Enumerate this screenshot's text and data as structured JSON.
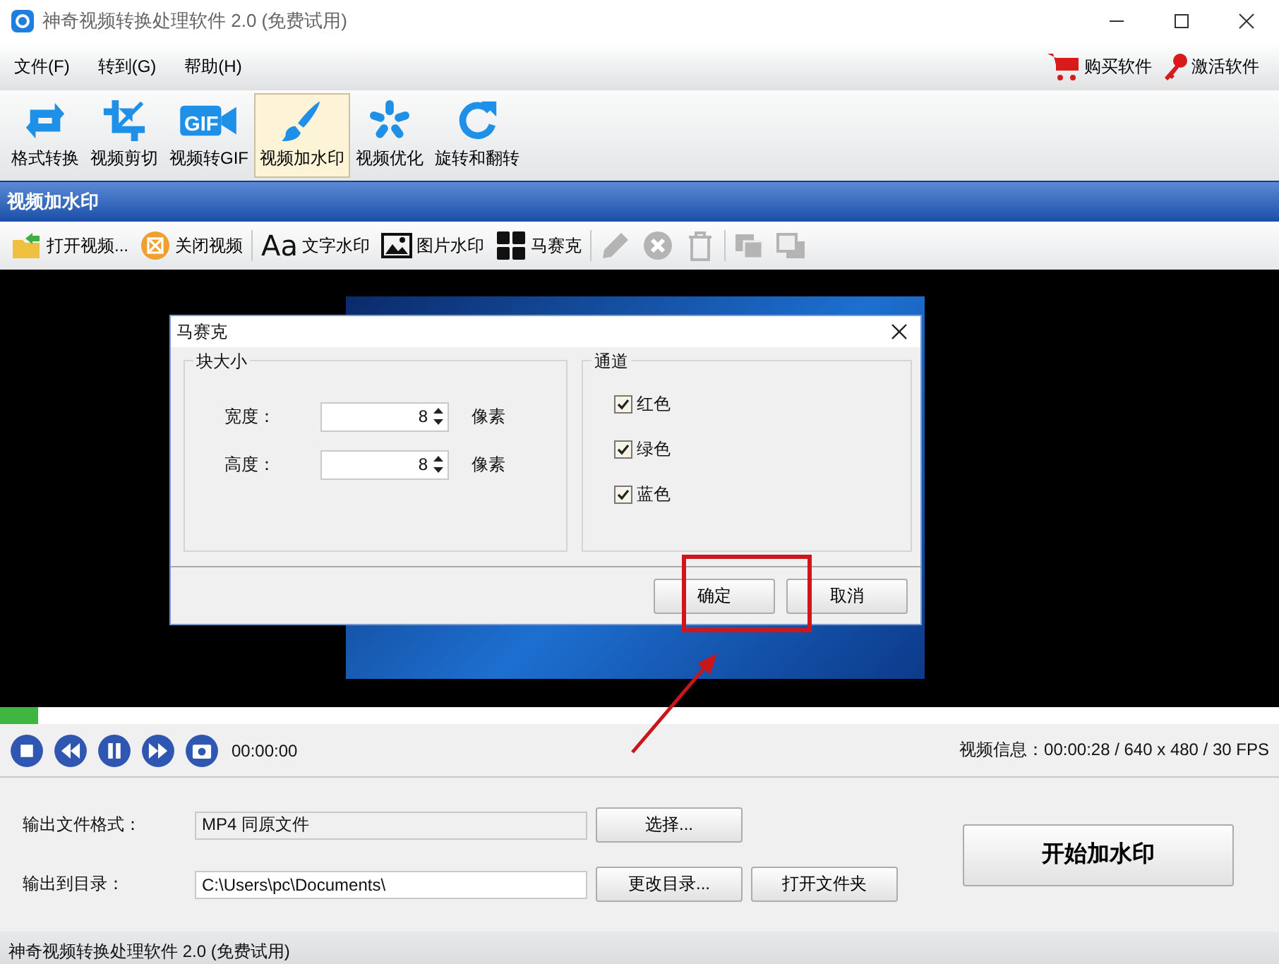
{
  "window": {
    "title": "神奇视频转换处理软件 2.0 (免费试用)"
  },
  "menu": [
    "文件(F)",
    "转到(G)",
    "帮助(H)"
  ],
  "menu_actions": [
    {
      "kind": "cart",
      "label": "购买软件"
    },
    {
      "kind": "key",
      "label": "激活软件"
    }
  ],
  "tools": [
    {
      "kind": "convert",
      "label": "格式转换",
      "selected": false
    },
    {
      "kind": "crop",
      "label": "视频剪切",
      "selected": false
    },
    {
      "kind": "gif",
      "icon_text": "GIF",
      "label": "视频转GIF",
      "selected": false
    },
    {
      "kind": "brush",
      "label": "视频加水印",
      "selected": true
    },
    {
      "kind": "optimize",
      "label": "视频优化",
      "selected": false
    },
    {
      "kind": "rotate",
      "label": "旋转和翻转",
      "selected": false
    }
  ],
  "section_title": "视频加水印",
  "actions": [
    {
      "kind": "open",
      "label": "打开视频...",
      "disabled": false
    },
    {
      "kind": "close",
      "label": "关闭视频",
      "disabled": false
    },
    {
      "kind": "text",
      "icon_text": "Aa",
      "label": "文字水印",
      "disabled": false
    },
    {
      "kind": "image",
      "label": "图片水印",
      "disabled": false
    },
    {
      "kind": "mosaic",
      "label": "马赛克",
      "disabled": false
    },
    {
      "kind": "edit",
      "disabled": true
    },
    {
      "kind": "remove",
      "disabled": true
    },
    {
      "kind": "delete",
      "disabled": true
    },
    {
      "kind": "back",
      "disabled": true
    },
    {
      "kind": "front",
      "disabled": true
    }
  ],
  "dialog": {
    "title": "马赛克",
    "block_size": {
      "title": "块大小",
      "fields": [
        {
          "label": "宽度：",
          "value": "8",
          "unit": "像素"
        },
        {
          "label": "高度：",
          "value": "8",
          "unit": "像素"
        }
      ]
    },
    "channels": {
      "title": "通道",
      "items": [
        {
          "label": "红色",
          "checked": true
        },
        {
          "label": "绿色",
          "checked": true
        },
        {
          "label": "蓝色",
          "checked": true
        }
      ]
    },
    "buttons": [
      "确定",
      "取消"
    ]
  },
  "progress": {
    "level": 0.03
  },
  "playback": {
    "buttons": [
      {
        "kind": "stop"
      },
      {
        "kind": "rewind"
      },
      {
        "kind": "pause"
      },
      {
        "kind": "forward"
      },
      {
        "kind": "snapshot"
      }
    ],
    "time": "00:00:00",
    "info": "视频信息：00:00:28 / 640 x 480 / 30 FPS"
  },
  "output": {
    "rows": [
      {
        "label": "输出文件格式：",
        "value": "MP4 同原文件",
        "buttons": [
          "选择..."
        ]
      },
      {
        "label": "输出到目录：",
        "value": "C:\\Users\\pc\\Documents\\",
        "buttons": [
          "更改目录...",
          "打开文件夹"
        ]
      }
    ],
    "start_button": "开始加水印"
  },
  "status_bar": "神奇视频转换处理软件 2.0 (免费试用)"
}
